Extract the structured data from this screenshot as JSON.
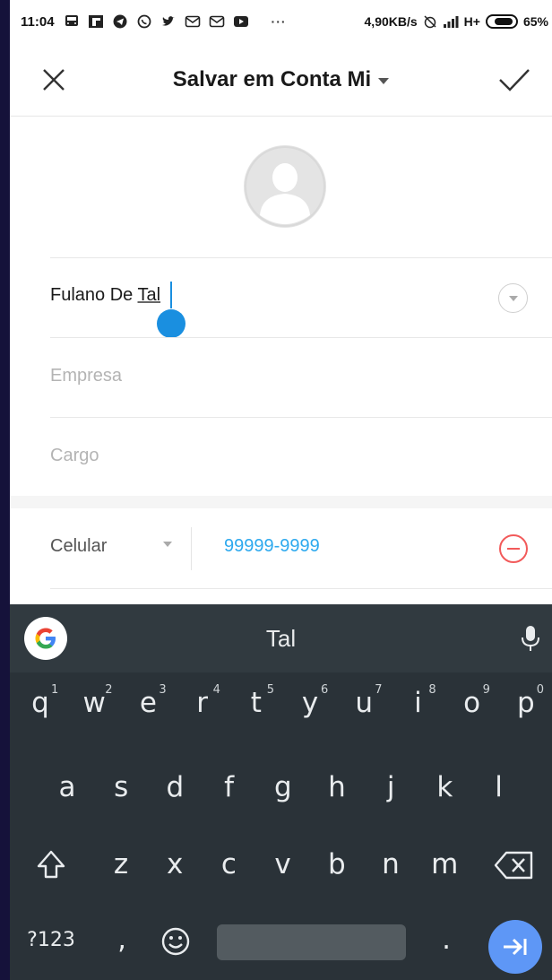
{
  "status_bar": {
    "time": "11:04",
    "network_speed": "4,90KB/s",
    "network_type": "H+",
    "battery": "65%",
    "more": "···",
    "icons": [
      "bus-icon",
      "flipboard-icon",
      "telegram-icon",
      "whatsapp-icon",
      "twitter-icon",
      "mail-icon",
      "mail-icon",
      "youtube-icon"
    ]
  },
  "toolbar": {
    "title": "Salvar em Conta Mi",
    "close_icon": "close-icon",
    "confirm_icon": "check-icon"
  },
  "form": {
    "name_prefix": "Fulano De ",
    "name_underlined": "Tal",
    "company_placeholder": "Empresa",
    "title_placeholder": "Cargo",
    "phone_type": "Celular",
    "phone_number": "99999-9999"
  },
  "colors": {
    "accent": "#2da9ee",
    "cursor": "#1a8fe0",
    "remove": "#f25a5a",
    "keyboard_bg": "#2a3238",
    "enter_key": "#5e97f6"
  },
  "keyboard": {
    "suggestion": "Tal",
    "row1": [
      "q",
      "w",
      "e",
      "r",
      "t",
      "y",
      "u",
      "i",
      "o",
      "p"
    ],
    "row1_hints": [
      "1",
      "2",
      "3",
      "4",
      "5",
      "6",
      "7",
      "8",
      "9",
      "0"
    ],
    "row2": [
      "a",
      "s",
      "d",
      "f",
      "g",
      "h",
      "j",
      "k",
      "l"
    ],
    "row3": [
      "z",
      "x",
      "c",
      "v",
      "b",
      "n",
      "m"
    ],
    "symbols_key": "?123",
    "comma_key": ",",
    "period_key": "."
  }
}
